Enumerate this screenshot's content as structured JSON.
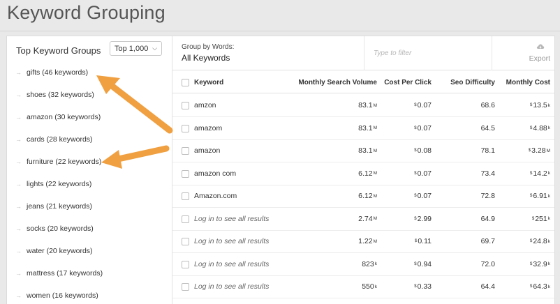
{
  "page": {
    "title": "Keyword Grouping"
  },
  "left_panel": {
    "title": "Top Keyword Groups",
    "top_select": {
      "value": "Top 1,000"
    },
    "groups": [
      {
        "label": "gifts (46 keywords)"
      },
      {
        "label": "shoes (32 keywords)"
      },
      {
        "label": "amazon (30 keywords)"
      },
      {
        "label": "cards (28 keywords)"
      },
      {
        "label": "furniture (22 keywords)"
      },
      {
        "label": "lights (22 keywords)"
      },
      {
        "label": "jeans (21 keywords)"
      },
      {
        "label": "socks (20 keywords)"
      },
      {
        "label": "water (20 keywords)"
      },
      {
        "label": "mattress (17 keywords)"
      },
      {
        "label": "women (16 keywords)"
      }
    ]
  },
  "toolbar": {
    "group_by_label": "Group by Words:",
    "group_by_value": "All Keywords",
    "filter_placeholder": "Type to filter",
    "export_label": "Export",
    "export_icon": "cloud-download-icon"
  },
  "table": {
    "headers": {
      "keyword": "Keyword",
      "volume": "Monthly Search Volume",
      "cpc": "Cost Per Click",
      "seo": "Seo Difficulty",
      "cost": "Monthly Cost"
    },
    "currency_symbol": "$",
    "rows": [
      {
        "keyword": "amzon",
        "volume": "83.1",
        "volume_unit": "M",
        "cpc": "0.07",
        "seo": "68.6",
        "cost": "13.5",
        "cost_unit": "k",
        "locked": false
      },
      {
        "keyword": "amazom",
        "volume": "83.1",
        "volume_unit": "M",
        "cpc": "0.07",
        "seo": "64.5",
        "cost": "4.88",
        "cost_unit": "k",
        "locked": false
      },
      {
        "keyword": "amazon",
        "volume": "83.1",
        "volume_unit": "M",
        "cpc": "0.08",
        "seo": "78.1",
        "cost": "3.28",
        "cost_unit": "M",
        "locked": false
      },
      {
        "keyword": "amazon com",
        "volume": "6.12",
        "volume_unit": "M",
        "cpc": "0.07",
        "seo": "73.4",
        "cost": "14.2",
        "cost_unit": "k",
        "locked": false
      },
      {
        "keyword": "Amazon.com",
        "volume": "6.12",
        "volume_unit": "M",
        "cpc": "0.07",
        "seo": "72.8",
        "cost": "6.91",
        "cost_unit": "k",
        "locked": false
      },
      {
        "keyword": "Log in to see all results",
        "volume": "2.74",
        "volume_unit": "M",
        "cpc": "2.99",
        "seo": "64.9",
        "cost": "251",
        "cost_unit": "k",
        "locked": true
      },
      {
        "keyword": "Log in to see all results",
        "volume": "1.22",
        "volume_unit": "M",
        "cpc": "0.11",
        "seo": "69.7",
        "cost": "24.8",
        "cost_unit": "k",
        "locked": true
      },
      {
        "keyword": "Log in to see all results",
        "volume": "823",
        "volume_unit": "k",
        "cpc": "0.94",
        "seo": "72.0",
        "cost": "32.9",
        "cost_unit": "k",
        "locked": true
      },
      {
        "keyword": "Log in to see all results",
        "volume": "550",
        "volume_unit": "k",
        "cpc": "0.33",
        "seo": "64.4",
        "cost": "64.3",
        "cost_unit": "k",
        "locked": true
      }
    ]
  },
  "annotation": {
    "arrow_color": "#f0a040"
  }
}
